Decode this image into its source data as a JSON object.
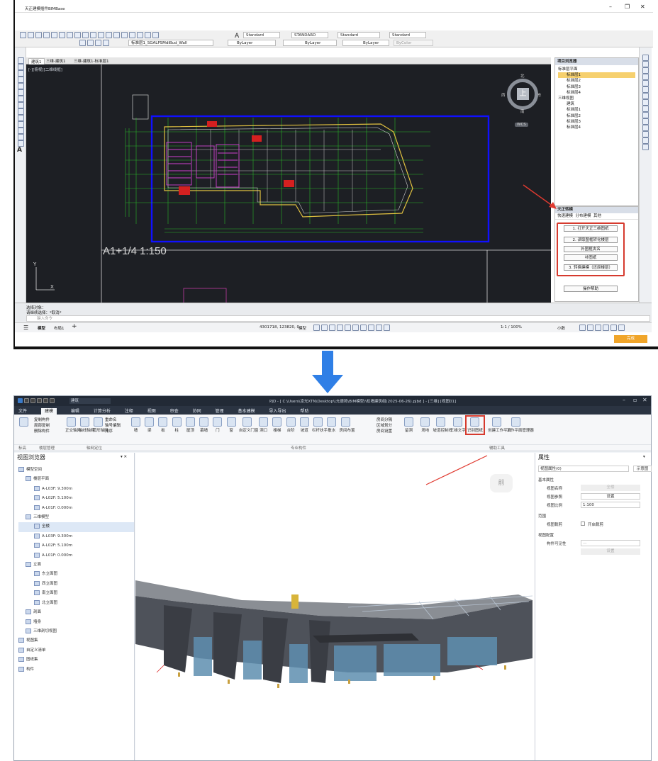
{
  "cad": {
    "title": "天正建模插件BIMBase",
    "window_controls": [
      "–",
      "❐",
      "✕"
    ],
    "toolbar": {
      "text_style": "Standard",
      "dim_style": "STANDARD",
      "table_style": "Standard",
      "multileader_style": "Standard",
      "layer": "标准层1_SGALPSMdiBud_Wall",
      "color": "ByLayer",
      "linetype": "ByLayer",
      "lineweight": "ByLayer",
      "plotstyle": "ByColor"
    },
    "tabs": [
      "建筑1",
      "三维-建筑1",
      "三维-建筑1-标准层1"
    ],
    "viewport_label": "[-][俯视][二维线框]",
    "compass": {
      "n": "北",
      "s": "南",
      "e": "东",
      "w": "西",
      "top": "上",
      "wcs": "WCS"
    },
    "drawing_label": "A1+1/4  1:150",
    "command_history": [
      "选择对象：",
      "请继续选择：*取消*"
    ],
    "command_prompt": "键入命令",
    "model_tabs": [
      "模型",
      "布局1"
    ],
    "coords": "4301718, 123820, 0",
    "model_label": "模型",
    "scale": "1:1 / 100%",
    "units": "小数",
    "project_browser": {
      "title": "项目浏览器",
      "items": [
        "标准层平面",
        "标准层1",
        "标准层2",
        "标准层3",
        "标准层4",
        "三维视图",
        "建筑",
        "标准层1",
        "标准层2",
        "标准层3",
        "标准层4"
      ]
    },
    "plugin": {
      "title": "天正转模",
      "tabs": [
        "快速建模",
        "分布建模",
        "其他"
      ],
      "buttons": [
        "1. 打开天正三维图纸",
        "2. 读取图框转化楼层",
        "补图框夹名",
        "补图纸",
        "3. 转换建模（还原楼层）"
      ],
      "help": "操作帮助"
    },
    "finish": "完成"
  },
  "bim": {
    "title": "PJD - [ C:\\Users\\凌光XTN\\Desktop\\\\允德苑\\BIM模型\\\\松墙建筑组(2025-06-26).pjbd ] - [三维] [视图01]",
    "doc_type": "建筑",
    "menus": [
      "文件",
      "建模",
      "编辑",
      "计算分析",
      "注释",
      "视图",
      "审查",
      "协同",
      "管理",
      "基本建模",
      "导入导出",
      "帮助"
    ],
    "ribbon_left": [
      "复制构件",
      "局部复制",
      "删除构件"
    ],
    "ribbon_grid": [
      "正交轴网",
      "轴线轴网",
      "弧形轴网"
    ],
    "ribbon_grid2": [
      "重命名",
      "轴号编辑",
      "排序"
    ],
    "ribbon_items": [
      "墙",
      "梁",
      "板",
      "柱",
      "屋顶",
      "幕墙",
      "门",
      "窗",
      "自定义门窗",
      "洞口",
      "楼梯",
      "台阶",
      "坡道",
      "栏杆扶手",
      "散水",
      "房间布置",
      "房间分隔",
      "区域划分",
      "房间设置",
      "留洞",
      "场地",
      "坡道控制线",
      "三维文字",
      "识别图纸",
      "创建工作平面",
      "工作平面管理器"
    ],
    "group_labels": [
      "标高",
      "楼层管理",
      "轴网定位",
      "专业构件",
      "辅助工具"
    ],
    "browser": {
      "title": "视图浏览器",
      "items": [
        "模型空间",
        "楼层平面",
        "A-L03F: 9.300m",
        "A-L02F: 5.100m",
        "A-L01F: 0.000m",
        "三维模型",
        "全楼",
        "A-L03F: 9.300m",
        "A-L02F: 5.100m",
        "A-L01F: 0.000m",
        "立面",
        "东立面图",
        "西立面图",
        "南立面图",
        "北立面图",
        "剖面",
        "墙身",
        "三维剖切视图",
        "视图集",
        "自定义清单",
        "图纸集",
        "构件"
      ]
    },
    "viewcube": "前",
    "props": {
      "title": "属性",
      "filter": "视图属性(0)",
      "show": "示意图",
      "section_basic": "基本属性",
      "view_name": "视图名称",
      "view_name_val": "全楼",
      "view_ref": "视图参照",
      "view_ref_val": "设置",
      "view_scale": "视图比例",
      "view_scale_val": "1:100",
      "section_range": "范围",
      "section_box": "视图裁剪",
      "section_box_val": "开启裁剪",
      "section_cfg": "视图配置",
      "component_vis": "构件可见性",
      "component_vis_val": "—",
      "set_btn": "设置"
    }
  },
  "colors": {
    "cad_bg": "#1d1f24",
    "blue_rect": "#1010ff",
    "highlight_red": "#d63a2e",
    "arrow_blue": "#2f7fe6",
    "bim_title": "#222a36"
  }
}
